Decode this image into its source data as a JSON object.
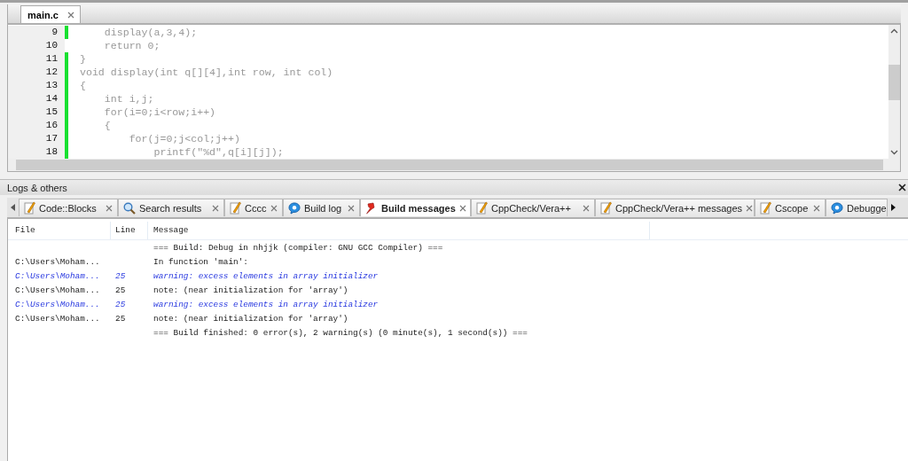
{
  "editor": {
    "tab": {
      "label": "main.c",
      "selected": true
    },
    "lines": [
      {
        "number": "9",
        "code": "    display(a,3,4);",
        "changed": true
      },
      {
        "number": "10",
        "code": "    return 0;",
        "changed": false
      },
      {
        "number": "11",
        "code": "}",
        "changed": true
      },
      {
        "number": "12",
        "code": "void display(int q[][4],int row, int col)",
        "changed": true
      },
      {
        "number": "13",
        "code": "{",
        "changed": true
      },
      {
        "number": "14",
        "code": "    int i,j;",
        "changed": true
      },
      {
        "number": "15",
        "code": "    for(i=0;i<row;i++)",
        "changed": true
      },
      {
        "number": "16",
        "code": "    {",
        "changed": true
      },
      {
        "number": "17",
        "code": "        for(j=0;j<col;j++)",
        "changed": true
      },
      {
        "number": "18",
        "code": "            printf(\"%d\",q[i][j]);",
        "changed": true
      }
    ]
  },
  "logs_panel": {
    "title": "Logs & others",
    "tabs": [
      {
        "label": "Code::Blocks",
        "kind": "note",
        "selected": false
      },
      {
        "label": "Search results",
        "kind": "search",
        "selected": false
      },
      {
        "label": "Cccc",
        "kind": "note",
        "selected": false
      },
      {
        "label": "Build log",
        "kind": "bubble",
        "selected": false
      },
      {
        "label": "Build messages",
        "kind": "pin",
        "selected": true
      },
      {
        "label": "CppCheck/Vera++",
        "kind": "note",
        "selected": false
      },
      {
        "label": "CppCheck/Vera++ messages",
        "kind": "note",
        "selected": false
      },
      {
        "label": "Cscope",
        "kind": "note",
        "selected": false
      },
      {
        "label": "Debugge",
        "kind": "bubble",
        "selected": false
      }
    ],
    "table": {
      "columns": [
        "File",
        "Line",
        "Message"
      ],
      "rows": [
        {
          "kind": "info",
          "file": "",
          "line": "",
          "message": "=== Build: Debug in nhjjk (compiler: GNU GCC Compiler) ==="
        },
        {
          "kind": "info",
          "file": "C:\\Users\\Moham...",
          "line": "",
          "message": "In function 'main':"
        },
        {
          "kind": "warning",
          "file": "C:\\Users\\Moham...",
          "line": "25",
          "message": "warning: excess elements in array initializer"
        },
        {
          "kind": "info",
          "file": "C:\\Users\\Moham...",
          "line": "25",
          "message": "note: (near initialization for 'array')"
        },
        {
          "kind": "warning",
          "file": "C:\\Users\\Moham...",
          "line": "25",
          "message": "warning: excess elements in array initializer"
        },
        {
          "kind": "info",
          "file": "C:\\Users\\Moham...",
          "line": "25",
          "message": "note: (near initialization for 'array')"
        },
        {
          "kind": "info",
          "file": "",
          "line": "",
          "message": "=== Build finished: 0 error(s), 2 warning(s) (0 minute(s), 1 second(s)) ==="
        }
      ]
    }
  }
}
